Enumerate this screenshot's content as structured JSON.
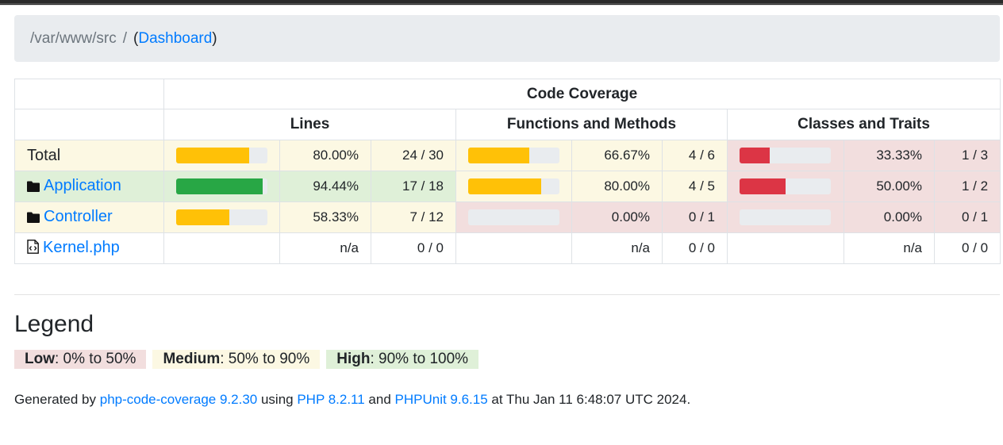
{
  "breadcrumb": {
    "path": "/var/www/src",
    "separator": "/",
    "link_label": "Dashboard",
    "open_paren": "(",
    "close_paren": ")"
  },
  "table": {
    "title": "Code Coverage",
    "groups": {
      "lines": "Lines",
      "functions": "Functions and Methods",
      "classes": "Classes and Traits"
    },
    "rows": [
      {
        "name": "Total",
        "icon": "none",
        "is_link": false,
        "lines": {
          "pct": "80.00%",
          "count": "24 / 30",
          "fraction": 0.8,
          "level": "medium"
        },
        "functions": {
          "pct": "66.67%",
          "count": "4 / 6",
          "fraction": 0.6667,
          "level": "medium"
        },
        "classes": {
          "pct": "33.33%",
          "count": "1 / 3",
          "fraction": 0.3333,
          "level": "low"
        }
      },
      {
        "name": "Application",
        "icon": "folder-icon",
        "is_link": true,
        "lines": {
          "pct": "94.44%",
          "count": "17 / 18",
          "fraction": 0.9444,
          "level": "high"
        },
        "functions": {
          "pct": "80.00%",
          "count": "4 / 5",
          "fraction": 0.8,
          "level": "medium"
        },
        "classes": {
          "pct": "50.00%",
          "count": "1 / 2",
          "fraction": 0.5,
          "level": "low"
        }
      },
      {
        "name": "Controller",
        "icon": "folder-icon",
        "is_link": true,
        "lines": {
          "pct": "58.33%",
          "count": "7 / 12",
          "fraction": 0.5833,
          "level": "medium"
        },
        "functions": {
          "pct": "0.00%",
          "count": "0 / 1",
          "fraction": 0.0,
          "level": "low"
        },
        "classes": {
          "pct": "0.00%",
          "count": "0 / 1",
          "fraction": 0.0,
          "level": "low"
        }
      },
      {
        "name": "Kernel.php",
        "icon": "code-file-icon",
        "is_link": true,
        "lines": {
          "pct": "n/a",
          "count": "0 / 0",
          "fraction": null,
          "level": "none"
        },
        "functions": {
          "pct": "n/a",
          "count": "0 / 0",
          "fraction": null,
          "level": "none"
        },
        "classes": {
          "pct": "n/a",
          "count": "0 / 0",
          "fraction": null,
          "level": "none"
        }
      }
    ]
  },
  "legend": {
    "title": "Legend",
    "items": [
      {
        "label": "Low",
        "range": ": 0% to 50%",
        "level": "low"
      },
      {
        "label": "Medium",
        "range": ": 50% to 90%",
        "level": "medium"
      },
      {
        "label": "High",
        "range": ": 90% to 100%",
        "level": "high"
      }
    ]
  },
  "footer": {
    "prefix": "Generated by ",
    "tool_link": "php-code-coverage 9.2.30",
    "using": " using ",
    "php_link": "PHP 8.2.11",
    "and": " and ",
    "phpunit_link": "PHPUnit 9.6.15",
    "suffix": " at Thu Jan 11 6:48:07 UTC 2024."
  },
  "colors": {
    "low_bg": "#f2dede",
    "medium_bg": "#fcf8e3",
    "high_bg": "#dff0d8",
    "low_bar": "#dc3545",
    "medium_bar": "#ffc107",
    "high_bar": "#28a745",
    "link": "#007bff"
  }
}
